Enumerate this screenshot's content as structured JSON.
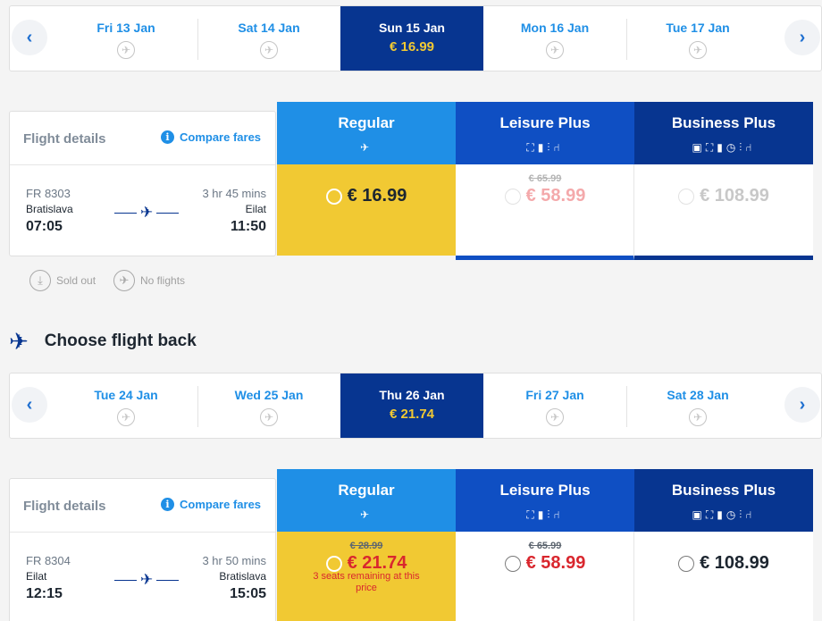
{
  "outbound": {
    "dates": [
      {
        "label": "Fri 13 Jan",
        "price": ""
      },
      {
        "label": "Sat 14 Jan",
        "price": ""
      },
      {
        "label": "Sun 15 Jan",
        "price": "€ 16.99"
      },
      {
        "label": "Mon 16 Jan",
        "price": ""
      },
      {
        "label": "Tue 17 Jan",
        "price": ""
      }
    ],
    "flight": {
      "title": "Flight details",
      "compare": "Compare fares",
      "number": "FR 8303",
      "duration": "3 hr 45 mins",
      "from": "Bratislava",
      "to": "Eilat",
      "depart": "07:05",
      "arrive": "11:50"
    },
    "fares": {
      "regular": {
        "name": "Regular",
        "price": "€ 16.99",
        "old": ""
      },
      "leisure": {
        "name": "Leisure Plus",
        "price": "€ 58.99",
        "old": "€ 65.99"
      },
      "business": {
        "name": "Business Plus",
        "price": "€ 108.99",
        "old": ""
      }
    }
  },
  "legend": {
    "sold_out": "Sold out",
    "no_flights": "No flights"
  },
  "back_title": "Choose flight back",
  "return": {
    "dates": [
      {
        "label": "Tue 24 Jan",
        "price": ""
      },
      {
        "label": "Wed 25 Jan",
        "price": ""
      },
      {
        "label": "Thu 26 Jan",
        "price": "€ 21.74"
      },
      {
        "label": "Fri 27 Jan",
        "price": ""
      },
      {
        "label": "Sat 28 Jan",
        "price": ""
      }
    ],
    "flight": {
      "title": "Flight details",
      "compare": "Compare fares",
      "number": "FR 8304",
      "duration": "3 hr 50 mins",
      "from": "Eilat",
      "to": "Bratislava",
      "depart": "12:15",
      "arrive": "15:05"
    },
    "fares": {
      "regular": {
        "name": "Regular",
        "price": "€ 21.74",
        "old": "€ 28.99",
        "note": "3 seats remaining at this price"
      },
      "leisure": {
        "name": "Leisure Plus",
        "price": "€ 58.99",
        "old": "€ 65.99"
      },
      "business": {
        "name": "Business Plus",
        "price": "€ 108.99",
        "old": ""
      }
    }
  },
  "icons": {
    "no_flight": "no-flight-icon",
    "plane": "airplane-icon",
    "info": "info-icon",
    "prev": "chevron-left-icon",
    "next": "chevron-right-icon"
  },
  "colors": {
    "brand_dark": "#073590",
    "brand_mid": "#0f4fc3",
    "brand_light": "#1f8fe6",
    "selected_yellow": "#f1c933",
    "price_red": "#d9272e"
  }
}
